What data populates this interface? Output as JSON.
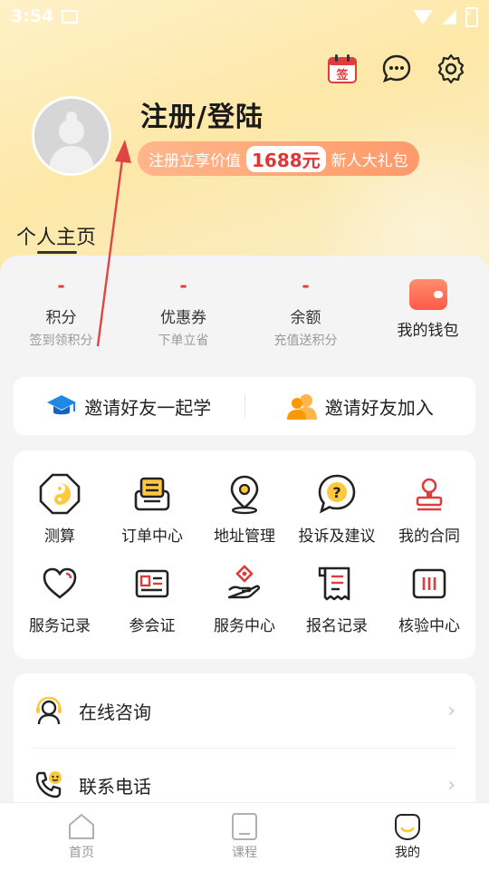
{
  "status_bar": {
    "time": "3:54"
  },
  "header": {
    "title": "注册/登陆",
    "promo_prefix": "注册立享价值",
    "promo_amount": "1688元",
    "promo_suffix": "新人大礼包",
    "personal_tab": "个人主页",
    "sign_badge": "签"
  },
  "stats": [
    {
      "value": "-",
      "label": "积分",
      "sub": "签到领积分"
    },
    {
      "value": "-",
      "label": "优惠券",
      "sub": "下单立省"
    },
    {
      "value": "-",
      "label": "余额",
      "sub": "充值送积分"
    }
  ],
  "wallet": {
    "label": "我的钱包"
  },
  "invite": {
    "study": "邀请好友一起学",
    "join": "邀请好友加入"
  },
  "services": [
    {
      "label": "测算",
      "icon": "bagua-icon"
    },
    {
      "label": "订单中心",
      "icon": "order-icon"
    },
    {
      "label": "地址管理",
      "icon": "location-icon"
    },
    {
      "label": "投诉及建议",
      "icon": "question-bubble-icon"
    },
    {
      "label": "我的合同",
      "icon": "stamp-icon"
    },
    {
      "label": "服务记录",
      "icon": "heart-icon"
    },
    {
      "label": "参会证",
      "icon": "id-card-icon"
    },
    {
      "label": "服务中心",
      "icon": "hand-service-icon"
    },
    {
      "label": "报名记录",
      "icon": "receipt-icon"
    },
    {
      "label": "核验中心",
      "icon": "verify-icon"
    }
  ],
  "list": [
    {
      "label": "在线咨询",
      "icon": "consult-icon"
    },
    {
      "label": "联系电话",
      "icon": "phone-icon"
    }
  ],
  "tabbar": [
    {
      "label": "首页",
      "icon": "home-icon",
      "active": false
    },
    {
      "label": "课程",
      "icon": "course-icon",
      "active": false
    },
    {
      "label": "我的",
      "icon": "me-icon",
      "active": true
    }
  ],
  "colors": {
    "accent_red": "#e03c3c",
    "promo_orange": "#ff9a6a",
    "hero_yellow": "#fde8a8",
    "annotation_red": "#e04444"
  }
}
